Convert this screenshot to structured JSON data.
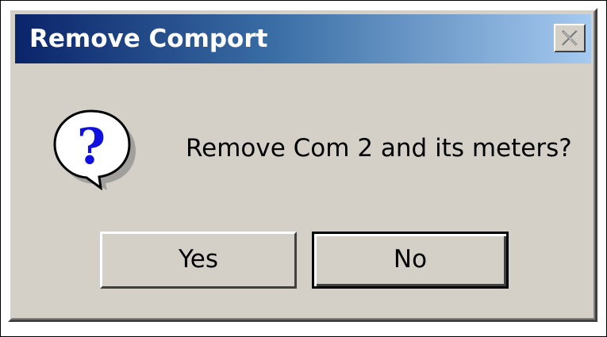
{
  "dialog": {
    "title": "Remove Comport",
    "message": "Remove Com 2 and its meters?",
    "close_icon": "close-icon",
    "icon": "question-icon",
    "buttons": {
      "yes_label": "Yes",
      "no_label": "No"
    }
  },
  "colors": {
    "titlebar_start": "#0a246a",
    "titlebar_end": "#a6caf0",
    "dialog_face": "#d4d0c8",
    "icon_question": "#1010e0"
  }
}
